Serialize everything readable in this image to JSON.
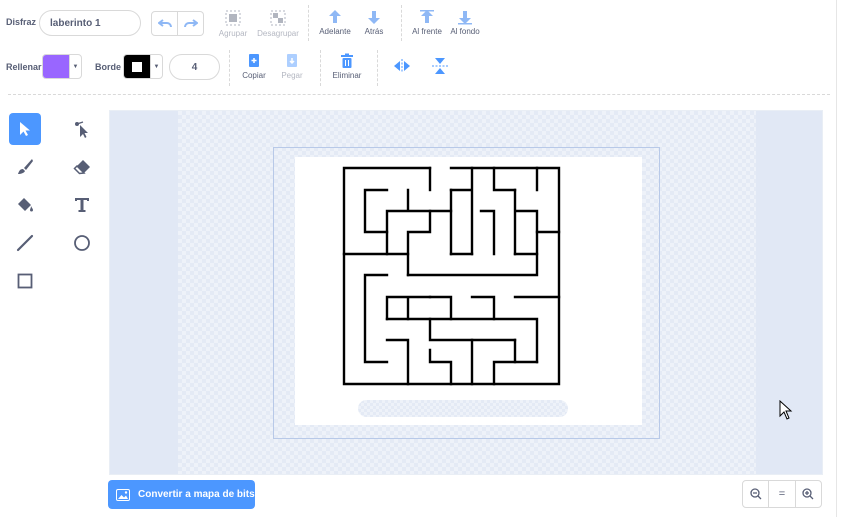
{
  "toolbar": {
    "costume_label": "Disfraz",
    "costume_name": "laberinto 1",
    "undo_icon": "undo-icon",
    "redo_icon": "redo-icon",
    "group": "Agrupar",
    "ungroup": "Desagrupar",
    "forward": "Adelante",
    "backward": "Atrás",
    "front": "Al frente",
    "back": "Al fondo",
    "fill_label": "Rellenar",
    "fill_color": "#9966ff",
    "outline_label": "Borde",
    "outline_color": "#000000",
    "outline_width": "4",
    "copy": "Copiar",
    "paste": "Pegar",
    "delete": "Eliminar",
    "flip_h_icon": "flip-horizontal-icon",
    "flip_v_icon": "flip-vertical-icon"
  },
  "tools": [
    "select-icon",
    "reshape-icon",
    "brush-icon",
    "eraser-icon",
    "fill-icon",
    "text-icon",
    "line-icon",
    "circle-icon",
    "rectangle-icon"
  ],
  "footer": {
    "convert_bitmap": "Convertir a mapa de bits",
    "zoom_out_icon": "zoom-out-icon",
    "zoom_reset": "=",
    "zoom_in_icon": "zoom-in-icon"
  },
  "colors": {
    "accent": "#4c97ff",
    "text": "#575e75"
  }
}
